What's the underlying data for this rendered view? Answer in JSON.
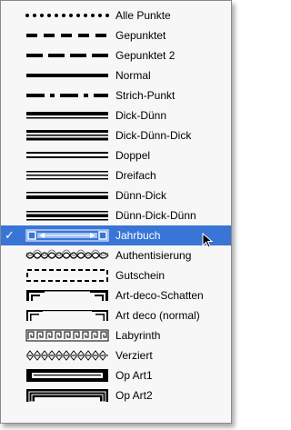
{
  "menu": {
    "selected_check": "✓",
    "items": [
      {
        "label": "Alle Punkte",
        "style": "dots"
      },
      {
        "label": "Gepunktet",
        "style": "dashes"
      },
      {
        "label": "Gepunktet 2",
        "style": "dashes2"
      },
      {
        "label": "Normal",
        "style": "solid"
      },
      {
        "label": "Strich-Punkt",
        "style": "dashdot"
      },
      {
        "label": "Dick-Dünn",
        "style": "thickthin"
      },
      {
        "label": "Dick-Dünn-Dick",
        "style": "thickthinthick"
      },
      {
        "label": "Doppel",
        "style": "double"
      },
      {
        "label": "Dreifach",
        "style": "triple"
      },
      {
        "label": "Dünn-Dick",
        "style": "thinthick"
      },
      {
        "label": "Dünn-Dick-Dünn",
        "style": "thinthickthin"
      },
      {
        "label": "Jahrbuch",
        "style": "yearbook",
        "selected": true
      },
      {
        "label": "Authentisierung",
        "style": "authentic"
      },
      {
        "label": "Gutschein",
        "style": "coupon"
      },
      {
        "label": "Art-deco-Schatten",
        "style": "artdecoshadow"
      },
      {
        "label": "Art deco (normal)",
        "style": "artdeco"
      },
      {
        "label": "Labyrinth",
        "style": "labyrinth"
      },
      {
        "label": "Verziert",
        "style": "ornate"
      },
      {
        "label": "Op Art1",
        "style": "opart1"
      },
      {
        "label": "Op Art2",
        "style": "opart2"
      }
    ]
  },
  "colors": {
    "highlight": "#3875d7",
    "menu_bg": "#f7f7f7"
  }
}
